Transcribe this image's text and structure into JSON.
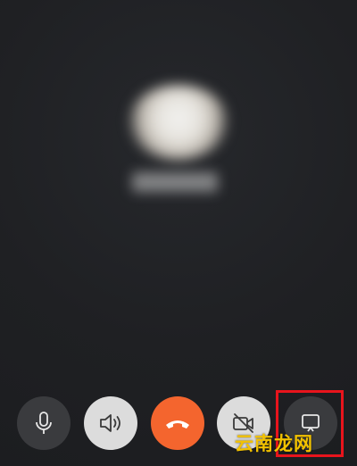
{
  "call": {
    "caller_avatar": "blurred-caller-avatar",
    "caller_name": ""
  },
  "controls": [
    {
      "id": "mic",
      "icon": "microphone-icon",
      "state": "on"
    },
    {
      "id": "speaker",
      "icon": "speaker-icon",
      "state": "active"
    },
    {
      "id": "hangup",
      "icon": "hang-up-icon",
      "color": "#f4652e"
    },
    {
      "id": "camera",
      "icon": "camera-off-icon",
      "state": "off"
    },
    {
      "id": "screen",
      "icon": "screen-share-icon",
      "highlighted": true
    }
  ],
  "colors": {
    "background": "#1f2023",
    "hangup": "#f4652e",
    "highlight": "#e8141c",
    "watermark": "#f2c200"
  },
  "watermark": {
    "text": "云南龙网"
  }
}
